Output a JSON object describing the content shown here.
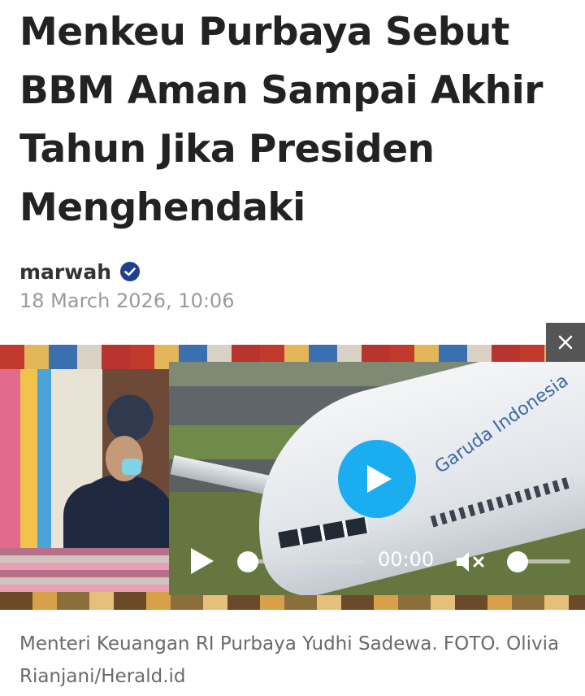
{
  "article": {
    "headline": "Menkeu Purbaya Sebut BBM Aman Sampai Akhir Tahun Jika Presiden Menghendaki",
    "author": "marwah",
    "date": "18 March 2026, 10:06",
    "caption": "Menteri Keuangan RI Purbaya Yudhi Sadewa. FOTO. Olivia Rianjani/Herald.id"
  },
  "video": {
    "time": "00:00",
    "progress": 0,
    "volume": 0,
    "muted": true,
    "brand_text": "Garuda Indonesia",
    "accent_color": "#1aaef0"
  },
  "icons": {
    "verified": "verified-check-icon",
    "close": "close-icon",
    "play": "play-icon",
    "mute": "volume-muted-icon"
  },
  "colors": {
    "verified_badge": "#1f3f8f",
    "close_bg": "#555555"
  }
}
